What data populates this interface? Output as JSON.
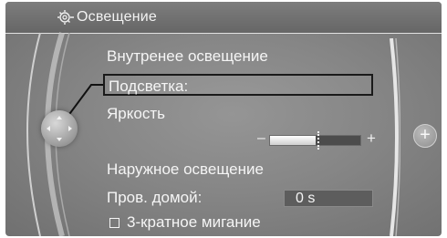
{
  "header": {
    "title": "Освещение",
    "icon": "light-settings-icon"
  },
  "menu": {
    "interior_heading": "Внутренее освещение",
    "backlight_label": "Подсветка:",
    "brightness_label": "Яркость",
    "brightness_level": 0.5,
    "slider_minus": "–",
    "slider_plus": "+",
    "exterior_heading": "Наружное освещение",
    "home_light_label": "Пров. домой:",
    "home_light_value": "0 s",
    "triple_flash_label": "3-кратное мигание",
    "triple_flash_checked": false
  },
  "controls": {
    "controller_icon": "controller-joystick-icon",
    "plus_icon": "plus-icon",
    "plus_symbol": "+"
  }
}
